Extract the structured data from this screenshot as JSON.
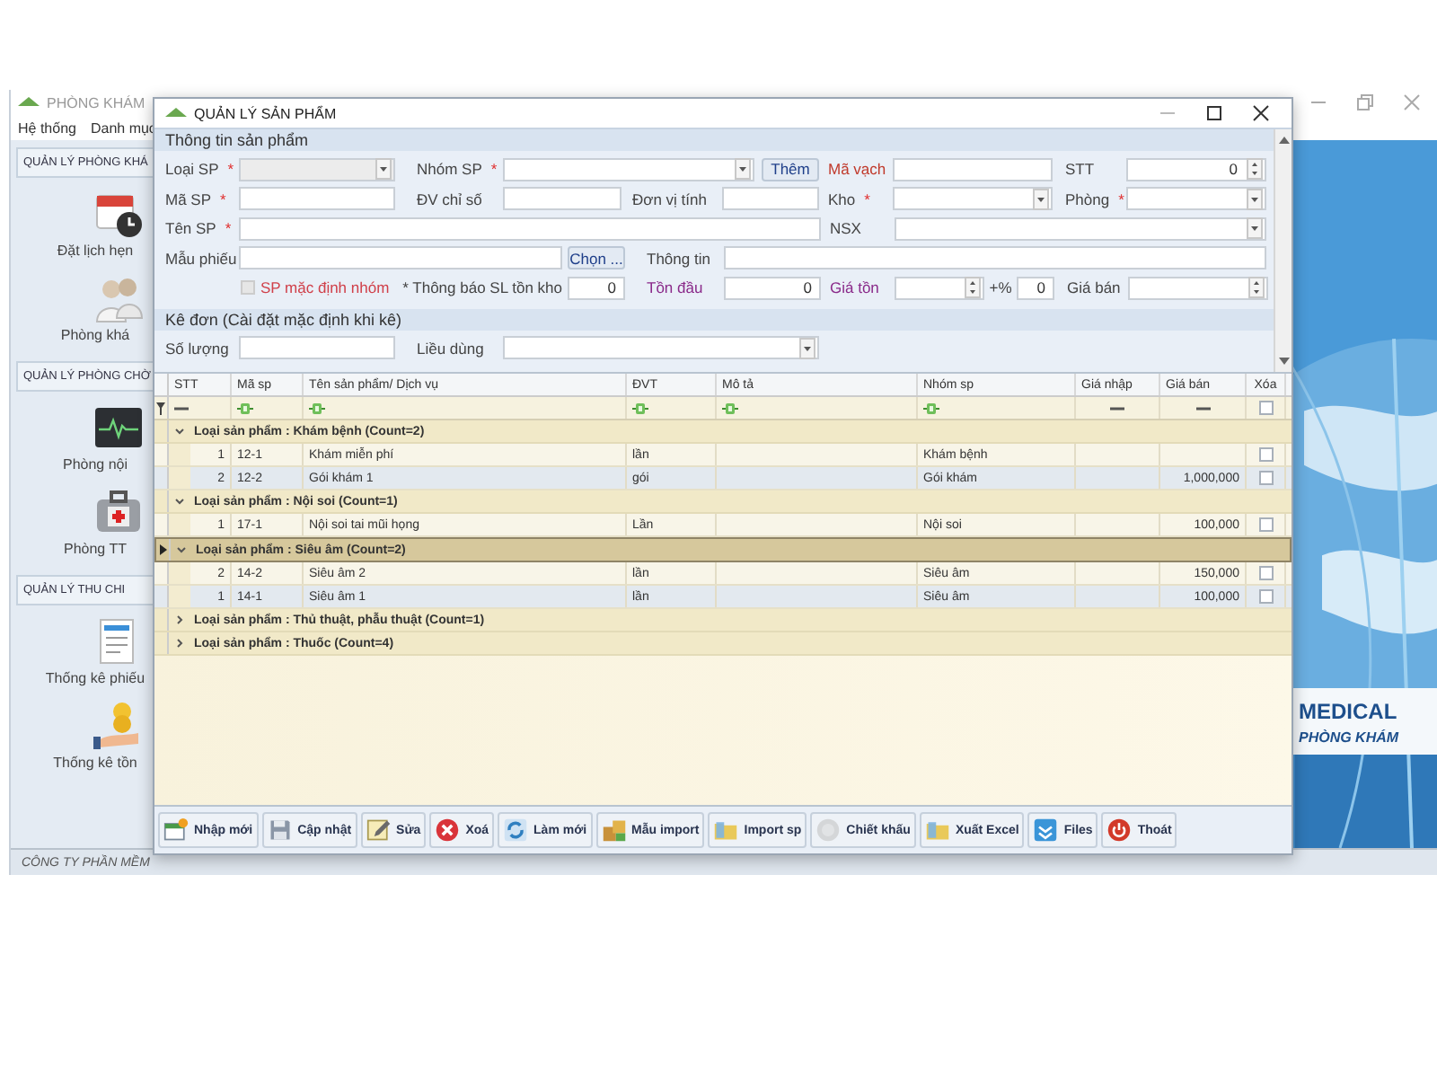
{
  "main_window": {
    "title": "PHÒNG KHÁM",
    "menu": [
      "Hệ thống",
      "Danh mục"
    ],
    "sidebar": [
      {
        "header": "QUẢN LÝ PHÒNG KHÁ",
        "items": [
          {
            "label": "Đặt lịch hẹn",
            "kind": "calendar"
          },
          {
            "label": "Phòng khá",
            "kind": "people"
          }
        ]
      },
      {
        "header": "QUẢN LÝ PHÒNG CHỜ",
        "items": [
          {
            "label": "Phòng nội",
            "kind": "monitor"
          },
          {
            "label": "Phòng TT",
            "kind": "medkit"
          }
        ]
      },
      {
        "header": "QUẢN LÝ THU CHI",
        "items": [
          {
            "label": "Thống kê phiếu",
            "kind": "receipt"
          },
          {
            "label": "Thống kê tồn",
            "kind": "coins"
          }
        ]
      }
    ],
    "banner": {
      "title": "MEDICAL",
      "subtitle": "PHÒNG KHÁM"
    },
    "status_bar": "CÔNG TY PHẦN MỀM"
  },
  "dialog": {
    "title": "QUẢN LÝ SẢN PHẨM",
    "product_info": {
      "title": "Thông tin sản phẩm",
      "fields": [
        {
          "label": "Loại SP",
          "mark": "*",
          "kind": "combo",
          "disabled": true
        },
        {
          "label": "Nhóm SP",
          "mark": "*",
          "kind": "combo",
          "button": "Thêm"
        },
        {
          "label": "Mã vạch",
          "kind": "text",
          "color": "#c0392b"
        },
        {
          "label": "STT",
          "kind": "spin",
          "value": "0"
        },
        {
          "label": "Mã SP",
          "mark": "*",
          "kind": "text"
        },
        {
          "label": "ĐV chỉ số",
          "kind": "text"
        },
        {
          "label": "Đơn vị tính",
          "kind": "text"
        },
        {
          "label": "Kho",
          "mark": "*",
          "kind": "combo"
        },
        {
          "label": "Phòng",
          "mark": "*",
          "kind": "combo"
        },
        {
          "label": "Tên SP",
          "mark": "*",
          "kind": "text"
        },
        {
          "label": "NSX",
          "kind": "combo"
        },
        {
          "label": "Mẫu phiếu",
          "kind": "text",
          "button": "Chọn ..."
        },
        {
          "label": "Thông tin",
          "kind": "text"
        },
        {
          "label": "SP mặc định nhóm",
          "kind": "checkbox",
          "checked": false,
          "disabled": true,
          "color": "#d0404a"
        },
        {
          "label": "* Thông báo SL tồn kho",
          "kind": "text",
          "value": "0"
        },
        {
          "label": "Tồn đầu",
          "kind": "text",
          "value": "0",
          "color": "#8a2a8a"
        },
        {
          "label": "Giá tồn",
          "kind": "spin",
          "color": "#8a2a8a"
        },
        {
          "label": "+%",
          "kind": "text",
          "value": "0"
        },
        {
          "label": "Giá bán",
          "kind": "spin"
        }
      ]
    },
    "prescription": {
      "title": "Kê đơn (Cài đặt mặc định khi kê)",
      "fields": [
        {
          "label": "Số lượng",
          "kind": "text"
        },
        {
          "label": "Liều dùng",
          "kind": "combo"
        }
      ]
    },
    "table": {
      "columns": [
        "STT",
        "Mã sp",
        "Tên sản phẩm/ Dịch vụ",
        "ĐVT",
        "Mô tả",
        "Nhóm sp",
        "Giá nhập",
        "Giá bán",
        "Xóa"
      ],
      "filter_row": [
        {
          "kind": "dash"
        },
        {
          "kind": "text"
        },
        {
          "kind": "text"
        },
        {
          "kind": "text"
        },
        {
          "kind": "text"
        },
        {
          "kind": "text"
        },
        {
          "kind": "dash"
        },
        {
          "kind": "dash"
        },
        {
          "kind": "checkbox",
          "checked": false
        }
      ],
      "groups": [
        {
          "label": "Loại sản phẩm : Khám bệnh (Count=2)",
          "expanded": true,
          "selected": false,
          "rows": [
            {
              "stt": "1",
              "code": "12-1",
              "name": "Khám miễn phí",
              "unit": "lần",
              "group": "Khám bệnh",
              "delete": false
            },
            {
              "stt": "2",
              "code": "12-2",
              "name": "Gói khám 1",
              "unit": "gói",
              "group": "Gói khám",
              "price": "1,000,000",
              "delete": false
            }
          ]
        },
        {
          "label": "Loại sản phẩm : Nội soi (Count=1)",
          "expanded": true,
          "selected": false,
          "rows": [
            {
              "stt": "1",
              "code": "17-1",
              "name": "Nội soi tai mũi họng",
              "unit": "Lần",
              "group": "Nội soi",
              "price": "100,000",
              "delete": false
            }
          ]
        },
        {
          "label": "Loại sản phẩm : Siêu âm (Count=2)",
          "expanded": true,
          "selected": true,
          "rows": [
            {
              "stt": "2",
              "code": "14-2",
              "name": "Siêu âm 2",
              "unit": "lần",
              "group": "Siêu âm",
              "price": "150,000",
              "delete": false
            },
            {
              "stt": "1",
              "code": "14-1",
              "name": "Siêu âm 1",
              "unit": "lần",
              "group": "Siêu âm",
              "price": "100,000",
              "delete": false
            }
          ]
        },
        {
          "label": "Loại sản phẩm : Thủ thuật, phẫu thuật (Count=1)",
          "expanded": false,
          "selected": false
        },
        {
          "label": "Loại sản phẩm : Thuốc (Count=4)",
          "expanded": false,
          "selected": false
        }
      ]
    },
    "toolbar": [
      {
        "label": "Nhập mới",
        "kind": "new",
        "disabled": false
      },
      {
        "label": "Cập nhật",
        "kind": "save",
        "disabled": false
      },
      {
        "label": "Sửa",
        "kind": "edit",
        "disabled": false
      },
      {
        "label": "Xoá",
        "kind": "delete",
        "disabled": false
      },
      {
        "label": "Làm mới",
        "kind": "refresh",
        "disabled": false
      },
      {
        "label": "Mẫu import",
        "kind": "template",
        "disabled": false
      },
      {
        "label": "Import sp",
        "kind": "folder",
        "disabled": false
      },
      {
        "label": "Chiết khấu",
        "kind": "discount",
        "disabled": true
      },
      {
        "label": "Xuất Excel",
        "kind": "folder",
        "disabled": false
      },
      {
        "label": "Files",
        "kind": "box",
        "disabled": false
      },
      {
        "label": "Thoát",
        "kind": "power",
        "disabled": false
      }
    ]
  }
}
